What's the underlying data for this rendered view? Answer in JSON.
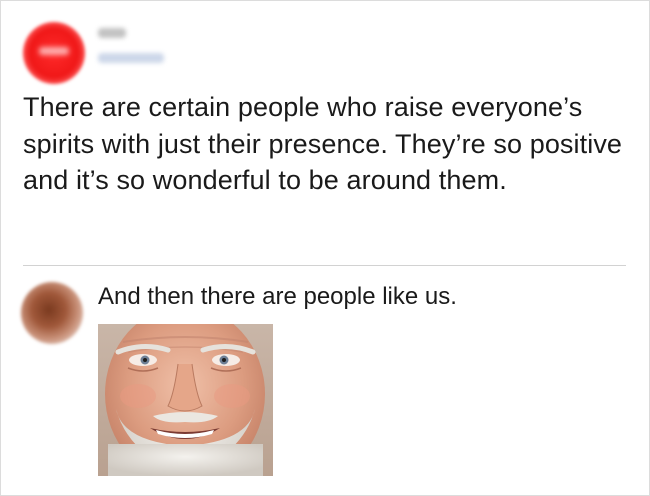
{
  "post": {
    "text": "There are certain people who raise everyone’s spirits with just their presence. They’re so positive and it’s so wonderful to be around them."
  },
  "reply": {
    "text": "And then there are people like us."
  },
  "colors": {
    "main_avatar": "#f01818",
    "reply_avatar": "#a0583a",
    "text": "#1a1a1a",
    "divider": "#d2d2d2"
  }
}
